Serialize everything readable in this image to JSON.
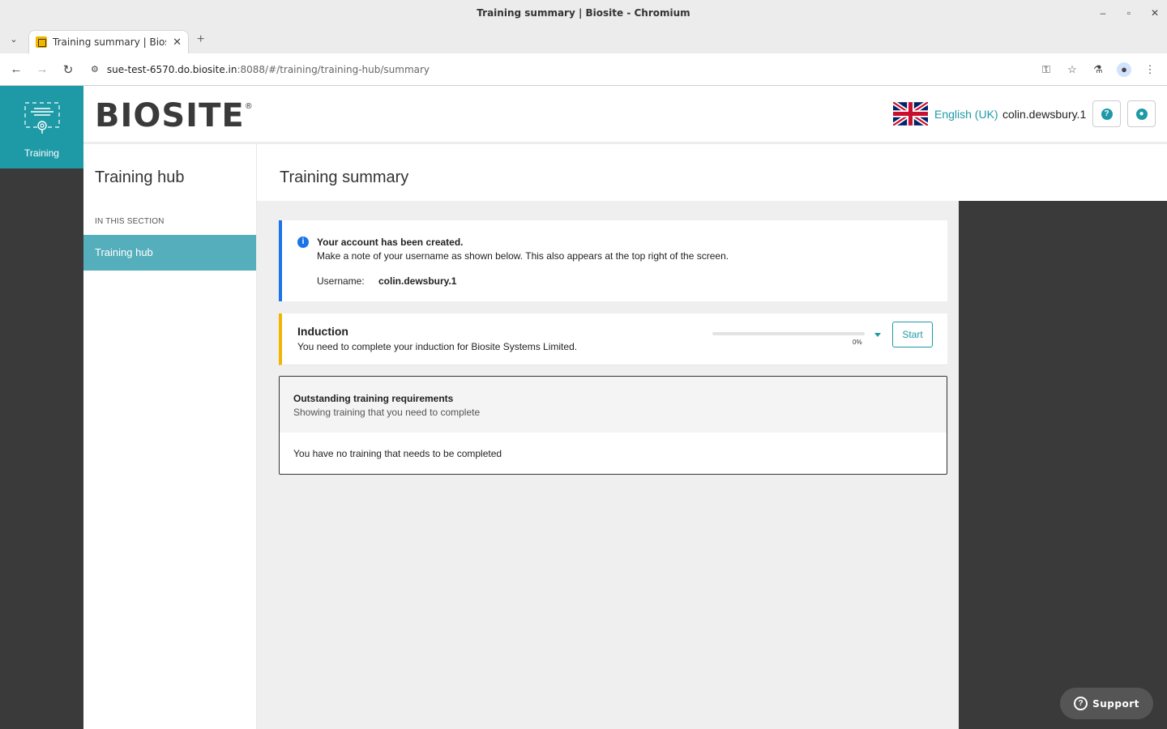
{
  "window": {
    "title": "Training summary | Biosite - Chromium"
  },
  "browser": {
    "tab_title": "Training summary | Biosite",
    "url_host": "sue-test-6570.do.biosite.in",
    "url_path": ":8088/#/training/training-hub/summary"
  },
  "app_nav": {
    "training_label": "Training"
  },
  "header": {
    "logo": "BIOSITE",
    "logo_mark": "®",
    "language": "English (UK)",
    "username": "colin.dewsbury.1"
  },
  "sidebar": {
    "title": "Training hub",
    "section_label": "IN THIS SECTION",
    "items": [
      {
        "label": "Training hub"
      }
    ]
  },
  "page": {
    "title": "Training summary"
  },
  "info_card": {
    "title": "Your account has been created.",
    "text": "Make a note of your username as shown below. This also appears at the top right of the screen.",
    "username_label": "Username:",
    "username_value": "colin.dewsbury.1"
  },
  "induction": {
    "title": "Induction",
    "text": "You need to complete your induction for Biosite Systems Limited.",
    "progress_percent": 0,
    "progress_label": "0%",
    "start_label": "Start"
  },
  "requirements": {
    "title": "Outstanding training requirements",
    "subtitle": "Showing training that you need to complete",
    "empty_text": "You have no training that needs to be completed"
  },
  "support": {
    "label": "Support"
  },
  "colors": {
    "teal": "#1e9aa6",
    "info_blue": "#1a73e8",
    "induction_yellow": "#f2b500"
  }
}
